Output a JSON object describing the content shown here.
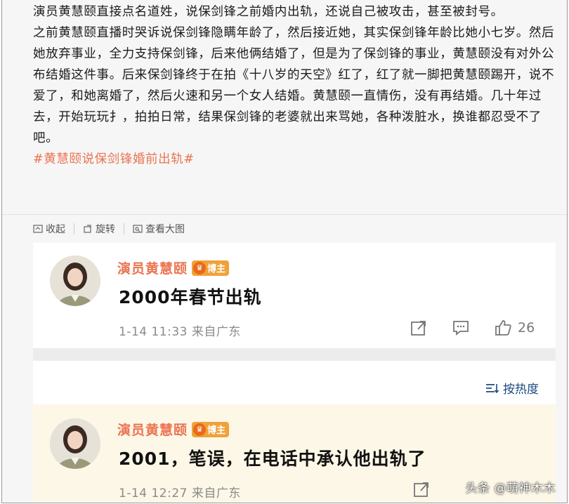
{
  "post": {
    "paragraph_1": "演员黄慧颐直接点名道姓，说保剑锋之前婚内出轨，还说自己被攻击，甚至被封号。",
    "paragraph_2": "之前黄慧颐直播时哭诉说保剑锋隐瞒年龄了，然后接近她，其实保剑锋年龄比她小七岁。然后她放弃事业，全力支持保剑锋，后来他俩结婚了，但是为了保剑锋的事业，黄慧颐没有对外公布结婚这件事。后来保剑锋终于在拍《十八岁的天空》红了，红了就一脚把黄慧颐踢开，说不爱了，和她离婚了，然后火速和另一个女人结婚。黄慧颐一直情伤，没有再结婚。几十年过去，开始玩玩扌，拍拍日常，结果保剑锋的老婆就出来骂她，各种泼脏水，换谁都忍受不了吧。",
    "hashtag": "#黄慧颐说保剑锋婚前出轨#"
  },
  "actions": {
    "collapse": "收起",
    "rotate": "旋转",
    "view_large": "查看大图"
  },
  "comments": [
    {
      "name": "演员黄慧颐",
      "badge": "博主",
      "text": "2000年春节出轨",
      "time": "1-14 11:33",
      "source": "来自广东",
      "likes": "26"
    },
    {
      "name": "演员黄慧颐",
      "badge": "博主",
      "text": "2001，笔误，在电话中承认他出轨了",
      "time": "1-14 12:27",
      "source": "来自广东"
    }
  ],
  "sort_label": "按热度",
  "watermark": "头条 @萌神木木",
  "colors": {
    "accent": "#eb7350",
    "link": "#1c4a80",
    "badge": "#f0a23a"
  }
}
